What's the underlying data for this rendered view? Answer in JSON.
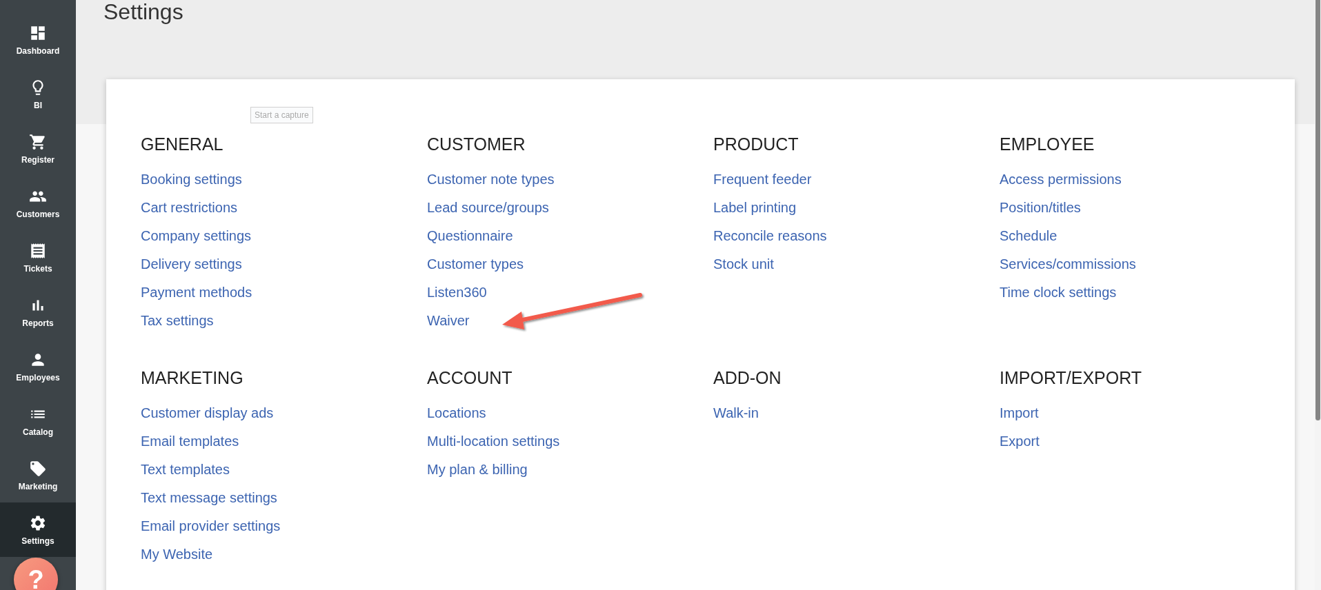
{
  "sidebar": {
    "items": [
      {
        "label": "Dashboard",
        "selected": false
      },
      {
        "label": "BI",
        "selected": false
      },
      {
        "label": "Register",
        "selected": false
      },
      {
        "label": "Customers",
        "selected": false
      },
      {
        "label": "Tickets",
        "selected": false
      },
      {
        "label": "Reports",
        "selected": false
      },
      {
        "label": "Employees",
        "selected": false
      },
      {
        "label": "Catalog",
        "selected": false
      },
      {
        "label": "Marketing",
        "selected": false
      },
      {
        "label": "Settings",
        "selected": true
      }
    ]
  },
  "help_button": {
    "label": "?"
  },
  "page_title": "Settings",
  "capture_tooltip": "Start a capture",
  "sections": [
    {
      "title": "GENERAL",
      "links": [
        "Booking settings",
        "Cart restrictions",
        "Company settings",
        "Delivery settings",
        "Payment methods",
        "Tax settings"
      ]
    },
    {
      "title": "CUSTOMER",
      "links": [
        "Customer note types",
        "Lead source/groups",
        "Questionnaire",
        "Customer types",
        "Listen360",
        "Waiver"
      ]
    },
    {
      "title": "PRODUCT",
      "links": [
        "Frequent feeder",
        "Label printing",
        "Reconcile reasons",
        "Stock unit"
      ]
    },
    {
      "title": "EMPLOYEE",
      "links": [
        "Access permissions",
        "Position/titles",
        "Schedule",
        "Services/commissions",
        "Time clock settings"
      ]
    },
    {
      "title": "MARKETING",
      "links": [
        "Customer display ads",
        "Email templates",
        "Text templates",
        "Text message settings",
        "Email provider settings",
        "My Website"
      ]
    },
    {
      "title": "ACCOUNT",
      "links": [
        "Locations",
        "Multi-location settings",
        "My plan & billing"
      ]
    },
    {
      "title": "ADD-ON",
      "links": [
        "Walk-in"
      ]
    },
    {
      "title": "IMPORT/EXPORT",
      "links": [
        "Import",
        "Export"
      ]
    }
  ]
}
